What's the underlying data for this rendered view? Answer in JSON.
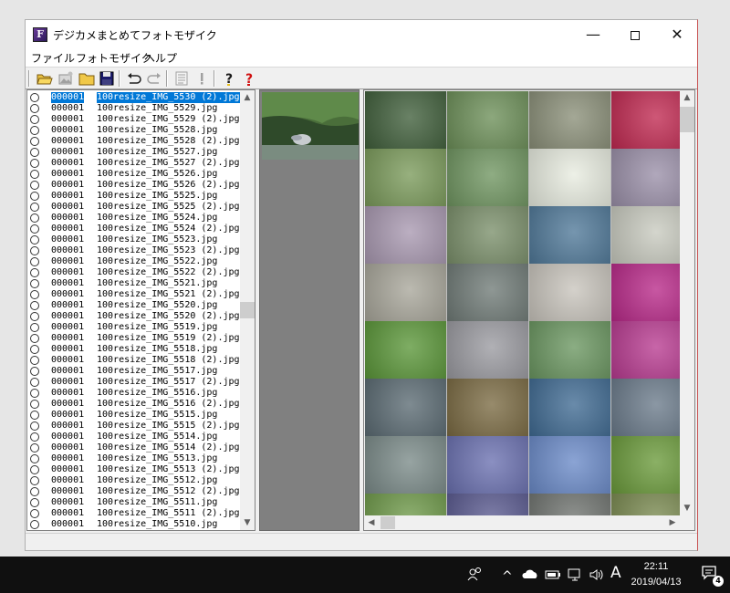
{
  "window": {
    "title": "デジカメまとめてフォトモザイク",
    "app_icon_letter": "F",
    "minimize_glyph": "—",
    "close_glyph": "✕"
  },
  "menu": [
    "ファイル",
    "フォトモザイク",
    "ヘルプ"
  ],
  "toolbar_icons": [
    "open-folder-icon",
    "add-image-icon",
    "folder-icon",
    "save-icon",
    "undo-icon",
    "redo-icon",
    "list-icon",
    "exclamation-icon",
    "help-icon",
    "context-help-icon"
  ],
  "file_list": [
    {
      "num": "000001",
      "name": "100resize_IMG_5530 (2).jpg",
      "selected": true
    },
    {
      "num": "000001",
      "name": "100resize_IMG_5529.jpg"
    },
    {
      "num": "000001",
      "name": "100resize_IMG_5529 (2).jpg"
    },
    {
      "num": "000001",
      "name": "100resize_IMG_5528.jpg"
    },
    {
      "num": "000001",
      "name": "100resize_IMG_5528 (2).jpg"
    },
    {
      "num": "000001",
      "name": "100resize_IMG_5527.jpg"
    },
    {
      "num": "000001",
      "name": "100resize_IMG_5527 (2).jpg"
    },
    {
      "num": "000001",
      "name": "100resize_IMG_5526.jpg"
    },
    {
      "num": "000001",
      "name": "100resize_IMG_5526 (2).jpg"
    },
    {
      "num": "000001",
      "name": "100resize_IMG_5525.jpg"
    },
    {
      "num": "000001",
      "name": "100resize_IMG_5525 (2).jpg"
    },
    {
      "num": "000001",
      "name": "100resize_IMG_5524.jpg"
    },
    {
      "num": "000001",
      "name": "100resize_IMG_5524 (2).jpg"
    },
    {
      "num": "000001",
      "name": "100resize_IMG_5523.jpg"
    },
    {
      "num": "000001",
      "name": "100resize_IMG_5523 (2).jpg"
    },
    {
      "num": "000001",
      "name": "100resize_IMG_5522.jpg"
    },
    {
      "num": "000001",
      "name": "100resize_IMG_5522 (2).jpg"
    },
    {
      "num": "000001",
      "name": "100resize_IMG_5521.jpg"
    },
    {
      "num": "000001",
      "name": "100resize_IMG_5521 (2).jpg"
    },
    {
      "num": "000001",
      "name": "100resize_IMG_5520.jpg"
    },
    {
      "num": "000001",
      "name": "100resize_IMG_5520 (2).jpg"
    },
    {
      "num": "000001",
      "name": "100resize_IMG_5519.jpg"
    },
    {
      "num": "000001",
      "name": "100resize_IMG_5519 (2).jpg"
    },
    {
      "num": "000001",
      "name": "100resize_IMG_5518.jpg"
    },
    {
      "num": "000001",
      "name": "100resize_IMG_5518 (2).jpg"
    },
    {
      "num": "000001",
      "name": "100resize_IMG_5517.jpg"
    },
    {
      "num": "000001",
      "name": "100resize_IMG_5517 (2).jpg"
    },
    {
      "num": "000001",
      "name": "100resize_IMG_5516.jpg"
    },
    {
      "num": "000001",
      "name": "100resize_IMG_5516 (2).jpg"
    },
    {
      "num": "000001",
      "name": "100resize_IMG_5515.jpg"
    },
    {
      "num": "000001",
      "name": "100resize_IMG_5515 (2).jpg"
    },
    {
      "num": "000001",
      "name": "100resize_IMG_5514.jpg"
    },
    {
      "num": "000001",
      "name": "100resize_IMG_5514 (2).jpg"
    },
    {
      "num": "000001",
      "name": "100resize_IMG_5513.jpg"
    },
    {
      "num": "000001",
      "name": "100resize_IMG_5513 (2).jpg"
    },
    {
      "num": "000001",
      "name": "100resize_IMG_5512.jpg"
    },
    {
      "num": "000001",
      "name": "100resize_IMG_5512 (2).jpg"
    },
    {
      "num": "000001",
      "name": "100resize_IMG_5511.jpg"
    },
    {
      "num": "000001",
      "name": "100resize_IMG_5511 (2).jpg"
    },
    {
      "num": "000001",
      "name": "100resize_IMG_5510.jpg"
    }
  ],
  "list_scroll_position": 0.5,
  "mosaic_tiles": [
    [
      "#3f5e3a",
      "#6c8f58",
      "#8a8f78",
      "#c02850"
    ],
    [
      "#7a9a5a",
      "#6f9560",
      "#e8ece0",
      "#9a8fa8"
    ],
    [
      "#a898b0",
      "#7a8f6a",
      "#4f7898",
      "#c8cabf"
    ],
    [
      "#a8a69a",
      "#6f7a76",
      "#c8c4bc",
      "#b82888"
    ],
    [
      "#5a9638",
      "#9a9aa0",
      "#6a9660",
      "#b83a90"
    ],
    [
      "#5a6a72",
      "#7a6a42",
      "#3f6a92",
      "#6a7a8a"
    ],
    [
      "#7a8a88",
      "#6a70b0",
      "#6a8ac8",
      "#6a9a3a"
    ],
    [
      "#6f9a4a",
      "#5a5a90",
      "#707470",
      "#7a8a50"
    ]
  ],
  "taskbar": {
    "time": "22:11",
    "date": "2019/04/13",
    "ime_glyph": "A",
    "notification_count": "4",
    "chevron_glyph": "^"
  }
}
